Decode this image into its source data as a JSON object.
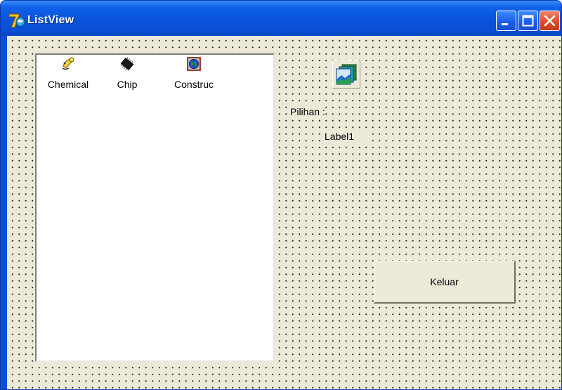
{
  "window": {
    "title": "ListView",
    "accent_color": "#0a4fd8",
    "close_color": "#e04a28",
    "face_color": "#ece9d8"
  },
  "listview": {
    "items": [
      {
        "label": "Chemical",
        "icon": "chemical-icon"
      },
      {
        "label": "Chip",
        "icon": "chip-icon"
      },
      {
        "label": "Construc",
        "icon": "construction-globe-icon"
      }
    ]
  },
  "form": {
    "pilihan_label": "Pilihan :",
    "selected_label": "Label1",
    "exit_button": "Keluar",
    "picture_icon": "image-stack-icon"
  }
}
